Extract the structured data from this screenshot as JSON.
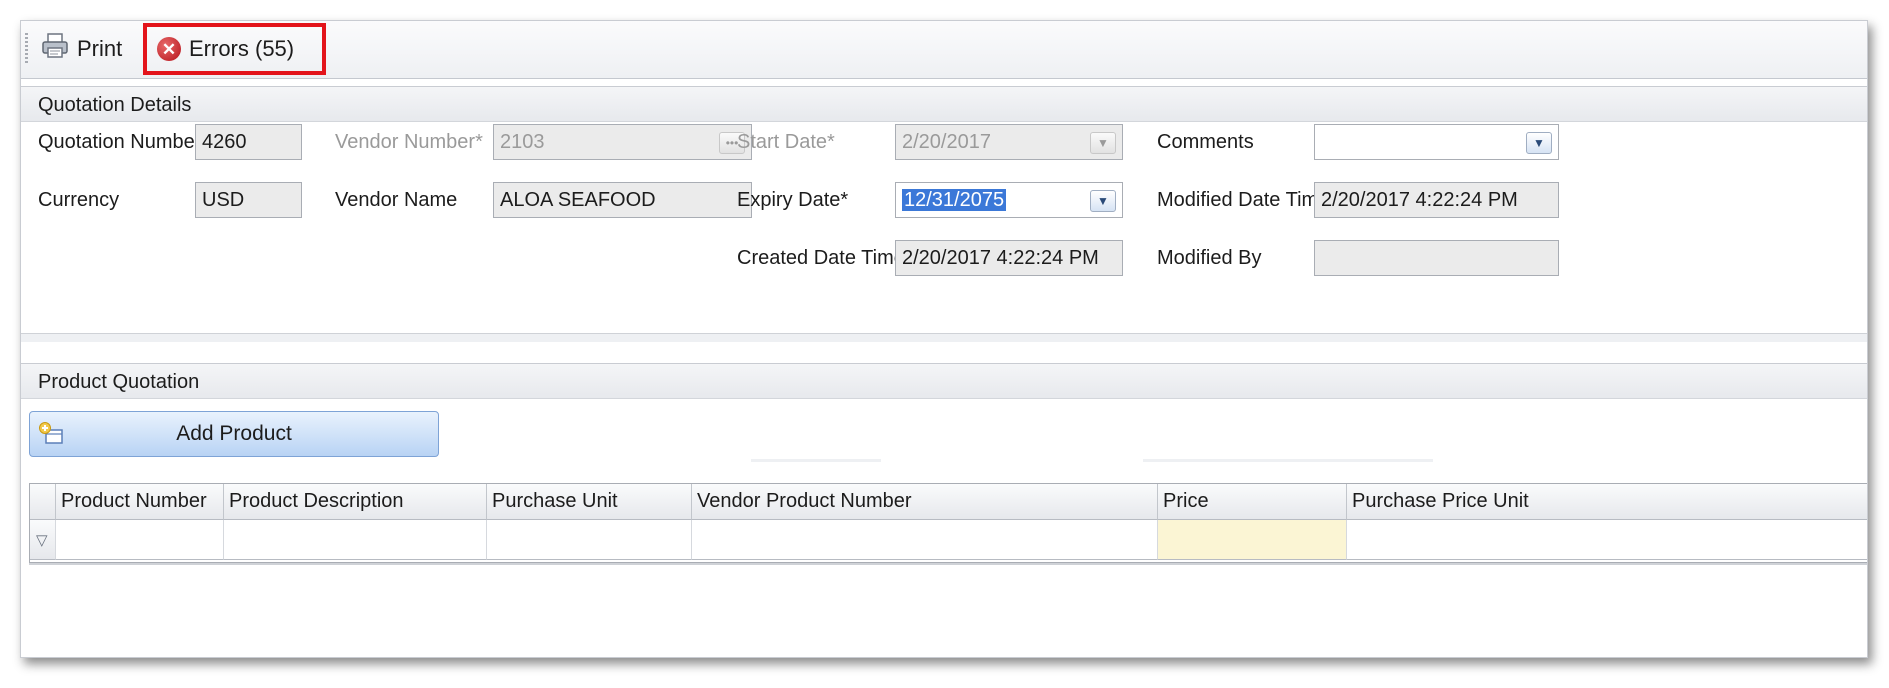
{
  "toolbar": {
    "print_label": "Print",
    "errors_label": "Errors (55)",
    "print_icon": "printer-icon",
    "errors_icon": "error-circle-icon"
  },
  "quotation_details": {
    "header": "Quotation Details",
    "quotation_number": {
      "label": "Quotation Number:",
      "value": "4260"
    },
    "currency": {
      "label": "Currency",
      "value": "USD"
    },
    "vendor_number": {
      "label": "Vendor Number*",
      "value": "2103"
    },
    "vendor_name": {
      "label": "Vendor Name",
      "value": "ALOA SEAFOOD"
    },
    "start_date": {
      "label": "Start Date*",
      "value": "2/20/2017"
    },
    "expiry_date": {
      "label": "Expiry Date*",
      "value": "12/31/2075"
    },
    "created_date_time": {
      "label": "Created Date Time",
      "value": "2/20/2017 4:22:24 PM"
    },
    "comments": {
      "label": "Comments",
      "value": ""
    },
    "modified_date_time": {
      "label": "Modified Date Time",
      "value": "2/20/2017 4:22:24 PM"
    },
    "modified_by": {
      "label": "Modified By",
      "value": ""
    }
  },
  "product_quotation": {
    "header": "Product Quotation",
    "add_button_label": "Add Product",
    "columns": [
      "Product Number",
      "Product Description",
      "Purchase Unit",
      "Vendor Product Number",
      "Price",
      "Purchase Price Unit"
    ]
  },
  "colors": {
    "error_highlight": "#e3141b",
    "selection": "#3b78d8",
    "price_cell": "#fbf5d4"
  }
}
